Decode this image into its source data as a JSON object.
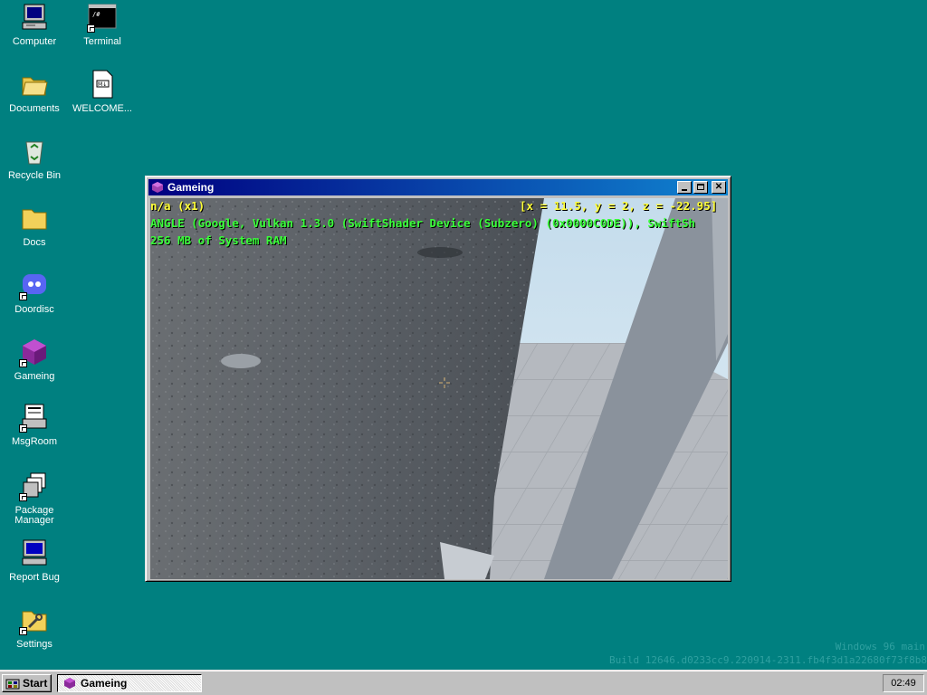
{
  "desktop": {
    "icons": [
      {
        "label": "Computer"
      },
      {
        "label": "Terminal"
      },
      {
        "label": "Documents"
      },
      {
        "label": "WELCOME..."
      },
      {
        "label": "Recycle Bin"
      },
      {
        "label": "Docs"
      },
      {
        "label": "Doordisc"
      },
      {
        "label": "Gameing"
      },
      {
        "label": "MsgRoom"
      },
      {
        "label": "Package Manager"
      },
      {
        "label": "Report Bug"
      },
      {
        "label": "Settings"
      }
    ],
    "background_color": "#008080"
  },
  "window": {
    "title": "Gameing",
    "icon": "purple-cube-icon",
    "buttons": {
      "minimize": "minimize-icon",
      "maximize": "maximize-icon",
      "close": "close-icon"
    },
    "hud": {
      "top_left": "n/a (x1)",
      "coordinates": "[x = 11.5, y = 2, z = -22.95]",
      "renderer": "ANGLE (Google, Vulkan 1.3.0 (SwiftShader Device (Subzero) (0x0000C0DE)), SwiftSh",
      "memory": "256 MB of System RAM",
      "yellow_color": "#ffff3a",
      "green_color": "#3aff3a"
    }
  },
  "taskbar": {
    "start_label": "Start",
    "task_label": "Gameing",
    "clock": "02:49"
  },
  "watermark": {
    "line1": "Windows 96 main",
    "line2": "Build 12646.d0233cc9.220914-2311.fb4f3d1a22680f73f8b8"
  }
}
